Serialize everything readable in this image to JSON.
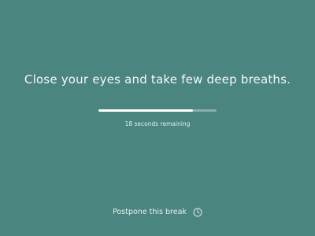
{
  "break": {
    "message": "Close your eyes and take few deep breaths.",
    "progress_fraction": 0.8,
    "remaining_text": "18 seconds remaining"
  },
  "postpone": {
    "label": "Postpone this break",
    "icon": "clock-icon"
  },
  "colors": {
    "background": "#4a857f",
    "text": "#ffffff",
    "progress_track": "#8fb5b0",
    "progress_fill": "#ffffff"
  }
}
